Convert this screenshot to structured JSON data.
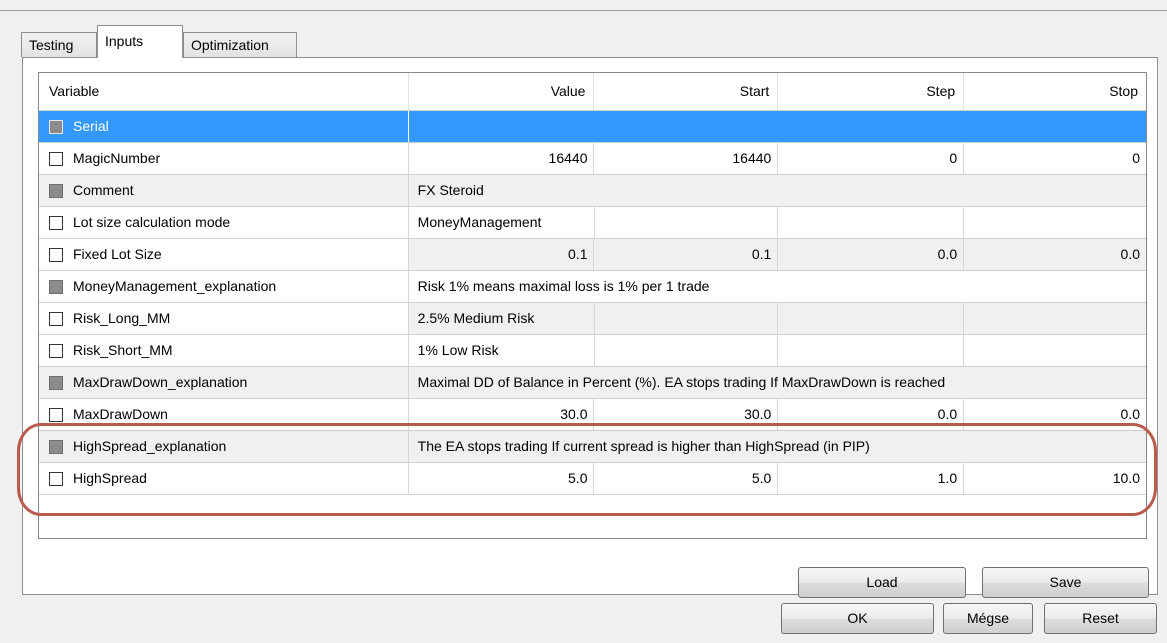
{
  "tabs": [
    {
      "label": "Testing"
    },
    {
      "label": "Inputs"
    },
    {
      "label": "Optimization"
    }
  ],
  "table": {
    "headers": {
      "variable": "Variable",
      "value": "Value",
      "start": "Start",
      "step": "Step",
      "stop": "Stop"
    },
    "rows": [
      {
        "name": "Serial",
        "value": "",
        "start": "",
        "step": "",
        "stop": ""
      },
      {
        "name": "MagicNumber",
        "value": "16440",
        "start": "16440",
        "step": "0",
        "stop": "0"
      },
      {
        "name": "Comment",
        "value": "FX Steroid"
      },
      {
        "name": "Lot size calculation mode",
        "value": "MoneyManagement",
        "start": "",
        "step": "",
        "stop": ""
      },
      {
        "name": "Fixed Lot Size",
        "value": "0.1",
        "start": "0.1",
        "step": "0.0",
        "stop": "0.0"
      },
      {
        "name": "MoneyManagement_explanation",
        "value": "Risk 1% means maximal loss is 1% per 1 trade"
      },
      {
        "name": "Risk_Long_MM",
        "value": "2.5% Medium Risk",
        "start": "",
        "step": "",
        "stop": ""
      },
      {
        "name": "Risk_Short_MM",
        "value": "1% Low Risk",
        "start": "",
        "step": "",
        "stop": ""
      },
      {
        "name": "MaxDrawDown_explanation",
        "value": "Maximal DD of Balance in Percent (%). EA stops trading If MaxDrawDown is reached"
      },
      {
        "name": "MaxDrawDown",
        "value": "30.0",
        "start": "30.0",
        "step": "0.0",
        "stop": "0.0"
      },
      {
        "name": "HighSpread_explanation",
        "value": "The EA stops trading If current spread is higher than HighSpread (in PIP)"
      },
      {
        "name": "HighSpread",
        "value": "5.0",
        "start": "5.0",
        "step": "1.0",
        "stop": "10.0"
      }
    ]
  },
  "buttons": {
    "load": "Load",
    "save": "Save",
    "ok": "OK",
    "cancel": "Mégse",
    "reset": "Reset"
  },
  "colors": {
    "selection": "#3399ff",
    "annotation": "#b95b4c"
  }
}
